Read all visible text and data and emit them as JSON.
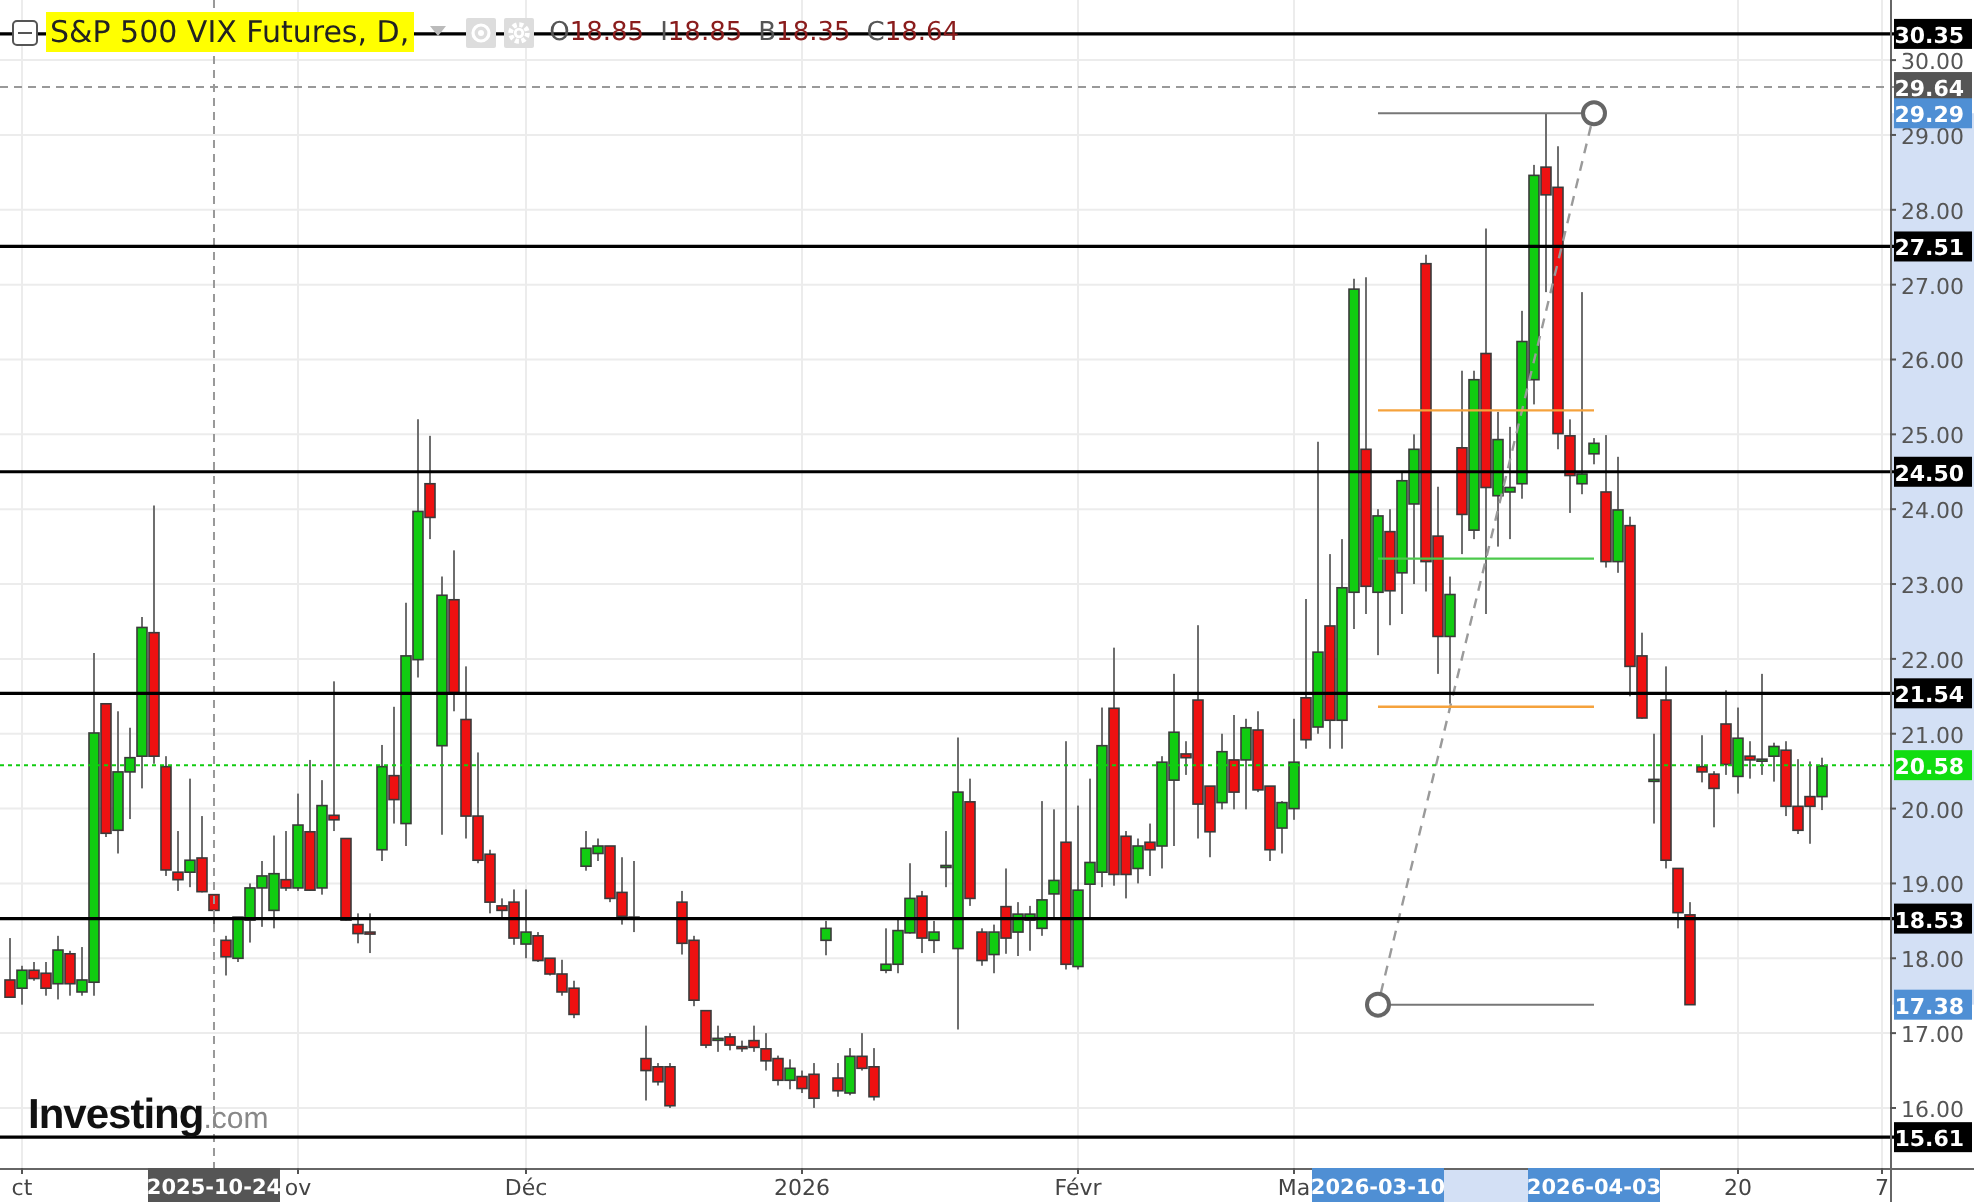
{
  "header": {
    "title": "S&P 500 VIX Futures, D,",
    "falling": true,
    "ohlc": [
      {
        "label": "O",
        "value": "18.85"
      },
      {
        "label": "I",
        "value": "18.85"
      },
      {
        "label": "B",
        "value": "18.35"
      },
      {
        "label": "C",
        "value": "18.64"
      }
    ]
  },
  "logo": {
    "name": "Investing",
    "suffix": ".com"
  },
  "chart": {
    "chart_data": {
      "type": "candlestick",
      "grid": true,
      "categories": [
        null,
        "ct",
        null,
        null,
        null,
        null,
        null,
        null,
        null,
        null,
        null,
        null,
        null,
        null,
        null,
        null,
        null,
        null,
        null,
        null,
        null,
        null,
        null,
        null,
        "ov",
        null,
        null,
        null,
        null,
        null,
        null,
        null,
        null,
        null,
        null,
        null,
        null,
        null,
        null,
        null,
        null,
        null,
        null,
        "Déc",
        null,
        null,
        null,
        null,
        null,
        null,
        null,
        null,
        null,
        null,
        null,
        null,
        null,
        null,
        null,
        null,
        null,
        null,
        null,
        null,
        null,
        null,
        "2026",
        null,
        null,
        null,
        null,
        null,
        null,
        null,
        null,
        null,
        null,
        null,
        null,
        null,
        null,
        null,
        null,
        null,
        null,
        null,
        null,
        null,
        null,
        "Févr",
        null,
        null,
        null,
        null,
        null,
        null,
        null,
        null,
        null,
        null,
        null,
        null,
        null,
        null,
        null,
        null,
        null,
        "Ma",
        null,
        null,
        null,
        null,
        null,
        null,
        null,
        null,
        null,
        null,
        null,
        null,
        null,
        null,
        null,
        null,
        null,
        null,
        null,
        null,
        null,
        null,
        null,
        null,
        null,
        null,
        null,
        null,
        null,
        null,
        null,
        null,
        null,
        null,
        null,
        null,
        "20",
        null,
        null,
        null,
        null,
        null,
        null,
        null,
        null,
        null,
        null,
        null,
        "7"
      ],
      "ylim": [
        15.198,
        30.803
      ],
      "yticks": [
        {
          "value": 16,
          "label": "16.00"
        },
        {
          "value": 17,
          "label": "17.00"
        },
        {
          "value": 18,
          "label": "18.00"
        },
        {
          "value": 19,
          "label": "19.00"
        },
        {
          "value": 20,
          "label": "20.00"
        },
        {
          "value": 21,
          "label": "21.00"
        },
        {
          "value": 22,
          "label": "22.00"
        },
        {
          "value": 23,
          "label": "23.00"
        },
        {
          "value": 24,
          "label": "24.00"
        },
        {
          "value": 25,
          "label": "25.00"
        },
        {
          "value": 26,
          "label": "26.00"
        },
        {
          "value": 27,
          "label": "27.00"
        },
        {
          "value": 28,
          "label": "28.00"
        },
        {
          "value": 29,
          "label": "29.00"
        },
        {
          "value": 30,
          "label": "30.00"
        }
      ],
      "ohlc": [
        [
          17.71,
          18.27,
          17.47,
          17.48
        ],
        [
          17.6,
          17.9,
          17.38,
          17.84
        ],
        [
          17.84,
          17.95,
          17.7,
          17.73
        ],
        [
          17.8,
          17.95,
          17.5,
          17.6
        ],
        [
          17.66,
          18.3,
          17.45,
          18.11
        ],
        [
          18.06,
          18.1,
          17.5,
          17.66
        ],
        [
          17.55,
          18.15,
          17.5,
          17.71
        ],
        [
          17.68,
          22.08,
          17.5,
          21.01
        ],
        [
          21.4,
          21.4,
          19.62,
          19.67
        ],
        [
          19.71,
          21.3,
          19.4,
          20.49
        ],
        [
          20.49,
          21.08,
          19.86,
          20.68
        ],
        [
          20.7,
          22.56,
          20.27,
          22.42
        ],
        [
          22.35,
          24.05,
          20.6,
          20.7
        ],
        [
          20.56,
          20.7,
          19.1,
          19.18
        ],
        [
          19.15,
          19.7,
          18.9,
          19.05
        ],
        [
          19.15,
          20.4,
          18.95,
          19.31
        ],
        [
          19.34,
          19.9,
          18.88,
          18.89
        ],
        [
          18.85,
          18.85,
          18.35,
          18.64
        ],
        [
          18.24,
          18.3,
          17.77,
          18.02
        ],
        [
          18.0,
          18.55,
          17.95,
          18.55
        ],
        [
          18.51,
          19.0,
          18.21,
          18.94
        ],
        [
          18.94,
          19.3,
          18.42,
          19.1
        ],
        [
          18.64,
          19.64,
          18.4,
          19.13
        ],
        [
          19.05,
          19.7,
          18.9,
          18.94
        ],
        [
          18.94,
          20.2,
          18.9,
          19.78
        ],
        [
          19.69,
          20.65,
          18.9,
          18.91
        ],
        [
          18.94,
          20.38,
          18.85,
          20.04
        ],
        [
          19.91,
          21.7,
          19.7,
          19.85
        ],
        [
          19.6,
          19.6,
          18.5,
          18.51
        ],
        [
          18.45,
          18.6,
          18.2,
          18.33
        ],
        [
          18.35,
          18.6,
          18.07,
          18.33
        ],
        [
          19.45,
          20.85,
          19.3,
          20.56
        ],
        [
          20.44,
          21.36,
          19.8,
          20.12
        ],
        [
          19.8,
          22.75,
          19.5,
          22.04
        ],
        [
          21.99,
          25.2,
          21.75,
          23.97
        ],
        [
          24.34,
          24.98,
          23.6,
          23.89
        ],
        [
          20.84,
          23.1,
          19.65,
          22.85
        ],
        [
          22.79,
          23.45,
          21.3,
          21.55
        ],
        [
          21.19,
          21.9,
          19.6,
          19.9
        ],
        [
          19.9,
          20.75,
          19.27,
          19.31
        ],
        [
          19.39,
          19.45,
          18.6,
          18.75
        ],
        [
          18.7,
          18.8,
          18.55,
          18.64
        ],
        [
          18.75,
          18.92,
          18.18,
          18.27
        ],
        [
          18.19,
          18.92,
          18.0,
          18.35
        ],
        [
          18.3,
          18.35,
          17.95,
          17.97
        ],
        [
          18.0,
          18.0,
          17.77,
          17.79
        ],
        [
          17.79,
          17.98,
          17.5,
          17.55
        ],
        [
          17.6,
          17.7,
          17.2,
          17.25
        ],
        [
          19.23,
          19.7,
          19.17,
          19.47
        ],
        [
          19.4,
          19.6,
          19.3,
          19.5
        ],
        [
          19.5,
          19.5,
          18.75,
          18.8
        ],
        [
          18.88,
          19.35,
          18.45,
          18.56
        ],
        [
          18.53,
          19.3,
          18.35,
          18.55
        ],
        [
          16.66,
          17.1,
          16.1,
          16.5
        ],
        [
          16.55,
          16.6,
          16.3,
          16.35
        ],
        [
          16.55,
          16.6,
          16.0,
          16.03
        ],
        [
          18.75,
          18.9,
          18.05,
          18.2
        ],
        [
          18.24,
          18.3,
          17.36,
          17.44
        ],
        [
          17.3,
          17.3,
          16.8,
          16.84
        ],
        [
          16.92,
          17.1,
          16.75,
          16.93
        ],
        [
          16.95,
          17.0,
          16.77,
          16.84
        ],
        [
          16.82,
          16.9,
          16.75,
          16.81
        ],
        [
          16.9,
          17.1,
          16.75,
          16.81
        ],
        [
          16.79,
          17.0,
          16.5,
          16.63
        ],
        [
          16.66,
          16.7,
          16.3,
          16.37
        ],
        [
          16.37,
          16.65,
          16.25,
          16.53
        ],
        [
          16.42,
          16.5,
          16.2,
          16.26
        ],
        [
          16.45,
          16.6,
          16.0,
          16.13
        ],
        [
          18.24,
          18.5,
          18.04,
          18.4
        ],
        [
          16.4,
          16.6,
          16.15,
          16.23
        ],
        [
          16.2,
          16.8,
          16.17,
          16.69
        ],
        [
          16.69,
          17.0,
          16.5,
          16.53
        ],
        [
          16.55,
          16.8,
          16.1,
          16.15
        ],
        [
          17.84,
          18.4,
          17.8,
          17.92
        ],
        [
          17.92,
          18.55,
          17.8,
          18.37
        ],
        [
          18.34,
          19.27,
          18.33,
          18.8
        ],
        [
          18.83,
          18.9,
          18.07,
          18.27
        ],
        [
          18.24,
          18.5,
          18.07,
          18.35
        ],
        [
          19.23,
          19.7,
          18.95,
          19.24
        ],
        [
          18.13,
          20.95,
          17.05,
          20.22
        ],
        [
          20.09,
          20.4,
          18.7,
          18.8
        ],
        [
          18.35,
          18.4,
          17.9,
          17.97
        ],
        [
          18.05,
          18.45,
          17.8,
          18.35
        ],
        [
          18.69,
          19.2,
          18.06,
          18.27
        ],
        [
          18.35,
          18.75,
          18.03,
          18.59
        ],
        [
          18.51,
          18.7,
          18.1,
          18.59
        ],
        [
          18.4,
          20.1,
          18.3,
          18.78
        ],
        [
          18.86,
          19.99,
          18.55,
          19.04
        ],
        [
          19.55,
          20.9,
          17.85,
          17.92
        ],
        [
          17.89,
          20.04,
          17.85,
          18.91
        ],
        [
          18.99,
          20.4,
          18.55,
          19.28
        ],
        [
          19.15,
          21.35,
          18.95,
          20.84
        ],
        [
          21.34,
          22.15,
          18.97,
          19.12
        ],
        [
          19.63,
          19.7,
          18.8,
          19.12
        ],
        [
          19.2,
          19.6,
          19.0,
          19.5
        ],
        [
          19.55,
          19.8,
          19.1,
          19.45
        ],
        [
          19.5,
          20.7,
          19.2,
          20.62
        ],
        [
          20.38,
          21.8,
          19.5,
          21.02
        ],
        [
          20.73,
          20.9,
          20.45,
          20.68
        ],
        [
          21.45,
          22.45,
          19.6,
          20.06
        ],
        [
          20.3,
          20.3,
          19.35,
          19.69
        ],
        [
          20.08,
          21.0,
          19.99,
          20.76
        ],
        [
          20.65,
          21.25,
          19.99,
          20.22
        ],
        [
          20.65,
          21.2,
          19.99,
          21.08
        ],
        [
          21.05,
          21.3,
          20.22,
          20.25
        ],
        [
          20.3,
          20.3,
          19.3,
          19.45
        ],
        [
          19.74,
          20.1,
          19.4,
          20.08
        ],
        [
          20.0,
          21.2,
          19.85,
          20.62
        ],
        [
          21.48,
          22.8,
          20.8,
          20.92
        ],
        [
          21.09,
          24.9,
          21.0,
          22.09
        ],
        [
          22.44,
          23.4,
          20.8,
          21.18
        ],
        [
          21.18,
          23.6,
          20.8,
          22.95
        ],
        [
          22.89,
          27.08,
          22.4,
          26.94
        ],
        [
          24.8,
          27.1,
          22.6,
          22.97
        ],
        [
          22.89,
          24.0,
          22.05,
          23.91
        ],
        [
          23.7,
          24.0,
          22.45,
          22.91
        ],
        [
          23.15,
          24.5,
          22.6,
          24.38
        ],
        [
          24.07,
          25.0,
          23.0,
          24.8
        ],
        [
          27.28,
          27.4,
          22.9,
          23.3
        ],
        [
          23.64,
          24.3,
          21.8,
          22.3
        ],
        [
          22.3,
          23.1,
          21.4,
          22.86
        ],
        [
          24.82,
          25.85,
          23.4,
          23.93
        ],
        [
          23.72,
          25.85,
          23.6,
          25.73
        ],
        [
          26.08,
          27.75,
          22.6,
          24.29
        ],
        [
          24.18,
          25.3,
          23.5,
          24.93
        ],
        [
          24.23,
          25.1,
          23.6,
          24.29
        ],
        [
          24.34,
          26.65,
          24.14,
          26.24
        ],
        [
          25.73,
          28.6,
          25.4,
          28.46
        ],
        [
          28.57,
          29.28,
          26.9,
          28.2
        ],
        [
          28.3,
          28.85,
          24.8,
          25.01
        ],
        [
          24.98,
          25.2,
          23.95,
          24.45
        ],
        [
          24.34,
          26.9,
          24.2,
          24.47
        ],
        [
          24.74,
          24.95,
          24.6,
          24.88
        ],
        [
          24.23,
          24.99,
          23.22,
          23.3
        ],
        [
          23.3,
          24.7,
          23.15,
          23.99
        ],
        [
          23.78,
          23.9,
          21.5,
          21.9
        ],
        [
          22.04,
          22.35,
          21.2,
          21.21
        ],
        [
          20.38,
          21.0,
          19.8,
          20.39
        ],
        [
          21.45,
          21.9,
          19.2,
          19.31
        ],
        [
          19.2,
          19.2,
          18.4,
          18.61
        ],
        [
          18.58,
          18.75,
          17.38,
          17.38
        ],
        [
          20.56,
          20.98,
          20.35,
          20.49
        ],
        [
          20.46,
          20.5,
          19.75,
          20.27
        ],
        [
          21.13,
          21.58,
          20.45,
          20.59
        ],
        [
          20.43,
          21.35,
          20.2,
          20.94
        ],
        [
          20.7,
          20.9,
          20.4,
          20.65
        ],
        [
          20.65,
          21.8,
          20.45,
          20.66
        ],
        [
          20.7,
          20.88,
          20.36,
          20.83
        ],
        [
          20.78,
          20.9,
          19.9,
          20.03
        ],
        [
          20.03,
          20.66,
          19.66,
          19.71
        ],
        [
          20.16,
          20.63,
          19.53,
          20.03
        ],
        [
          20.16,
          20.68,
          19.98,
          20.57
        ],
        null,
        null,
        null,
        null,
        null
      ],
      "ref_lines": [
        {
          "axis": "y",
          "value": 30.35,
          "label": "30.35",
          "color": "#000000"
        },
        {
          "axis": "y",
          "value": 29.64,
          "label": "29.64",
          "color": "#999999"
        },
        {
          "axis": "y",
          "value": 27.51,
          "label": "27.51",
          "color": "#000000"
        },
        {
          "axis": "y",
          "value": 25.32,
          "color": "#f5a23c"
        },
        {
          "axis": "y",
          "value": 24.5,
          "label": "24.50",
          "color": "#000000"
        },
        {
          "axis": "y",
          "value": 23.34,
          "color": "#4cc94c"
        },
        {
          "axis": "y",
          "value": 21.54,
          "label": "21.54",
          "color": "#000000"
        },
        {
          "axis": "y",
          "value": 21.36,
          "color": "#f5a23c"
        },
        {
          "axis": "y",
          "value": 20.58,
          "label": "20.58",
          "color": "#11cc11"
        },
        {
          "axis": "y",
          "value": 18.53,
          "label": "18.53",
          "color": "#000000"
        },
        {
          "axis": "y",
          "value": 15.61,
          "label": "15.61",
          "color": "#000000"
        }
      ]
    },
    "crosshair": {
      "date_label": "2025-10-24"
    },
    "range_tool": {
      "price_labels": [
        "29.29",
        "17.38"
      ],
      "date_labels": [
        "2026-03-10",
        "2026-04-03"
      ]
    }
  }
}
